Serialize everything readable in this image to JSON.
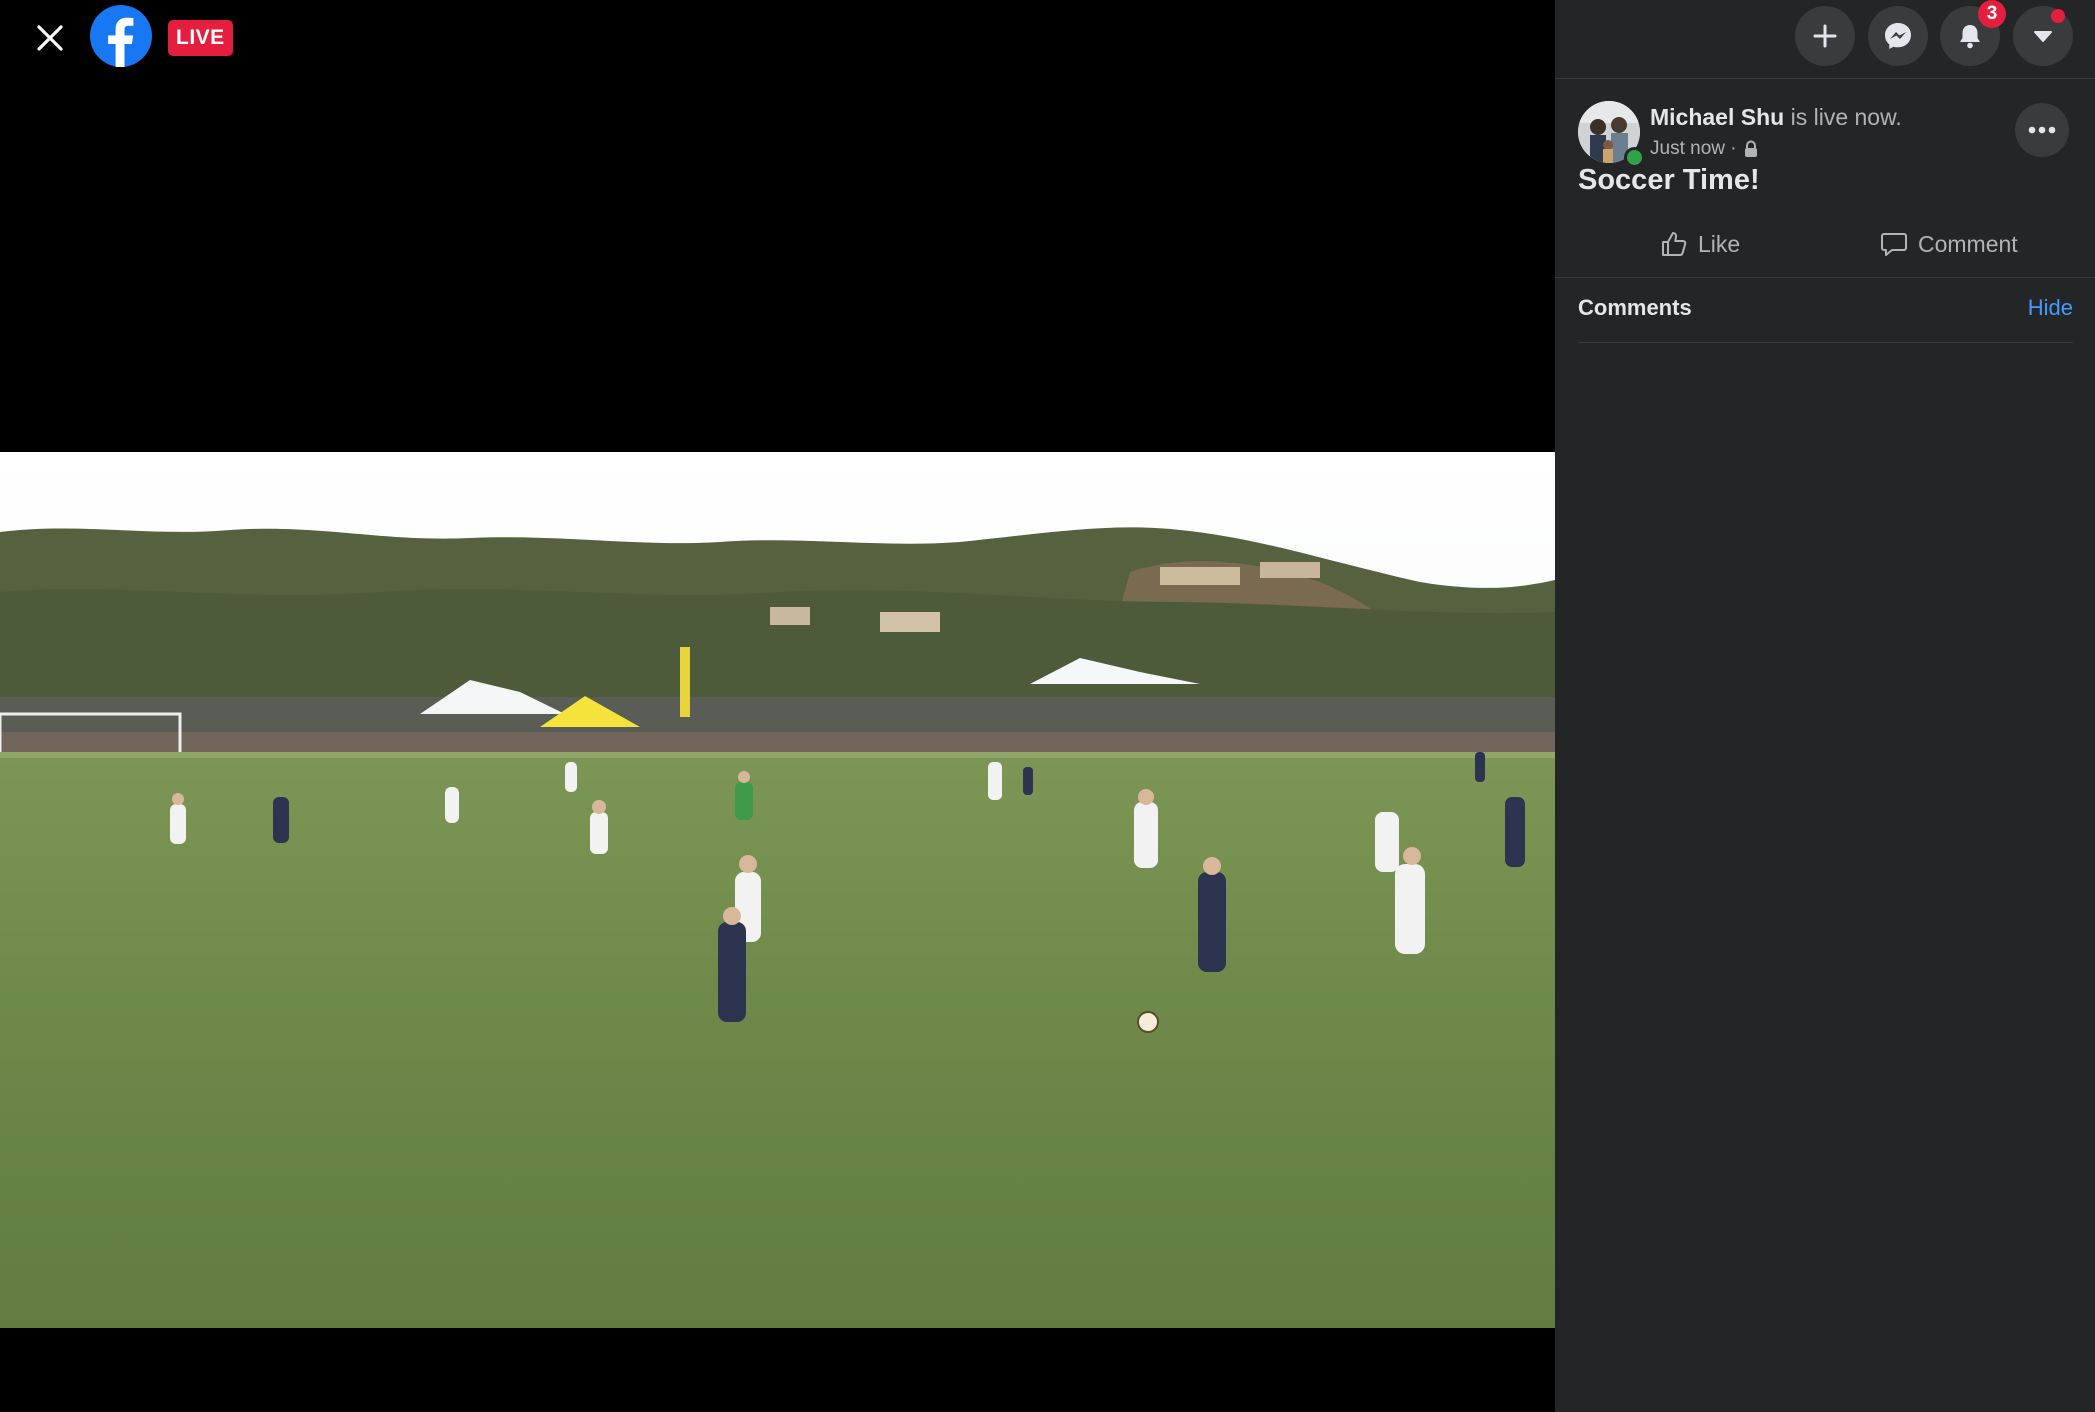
{
  "viewer": {
    "live_label": "LIVE",
    "close_icon": "close-icon",
    "logo_icon": "facebook-logo"
  },
  "topbar": {
    "create_icon": "plus-icon",
    "messenger_icon": "messenger-icon",
    "notifications_icon": "bell-icon",
    "notifications_count": "3",
    "account_icon": "caret-down-icon"
  },
  "post": {
    "author": "Michael Shu",
    "status": "is live now.",
    "timestamp": "Just now ·",
    "privacy_icon": "lock-icon",
    "title": "Soccer Time!",
    "more_icon": "more-icon"
  },
  "actions": {
    "like_label": "Like",
    "comment_label": "Comment"
  },
  "comments": {
    "heading": "Comments",
    "hide_label": "Hide"
  },
  "colors": {
    "sidebar_bg": "#242526",
    "live_red": "#e41e3f",
    "link_blue": "#4599ff",
    "online_green": "#31a24c"
  }
}
